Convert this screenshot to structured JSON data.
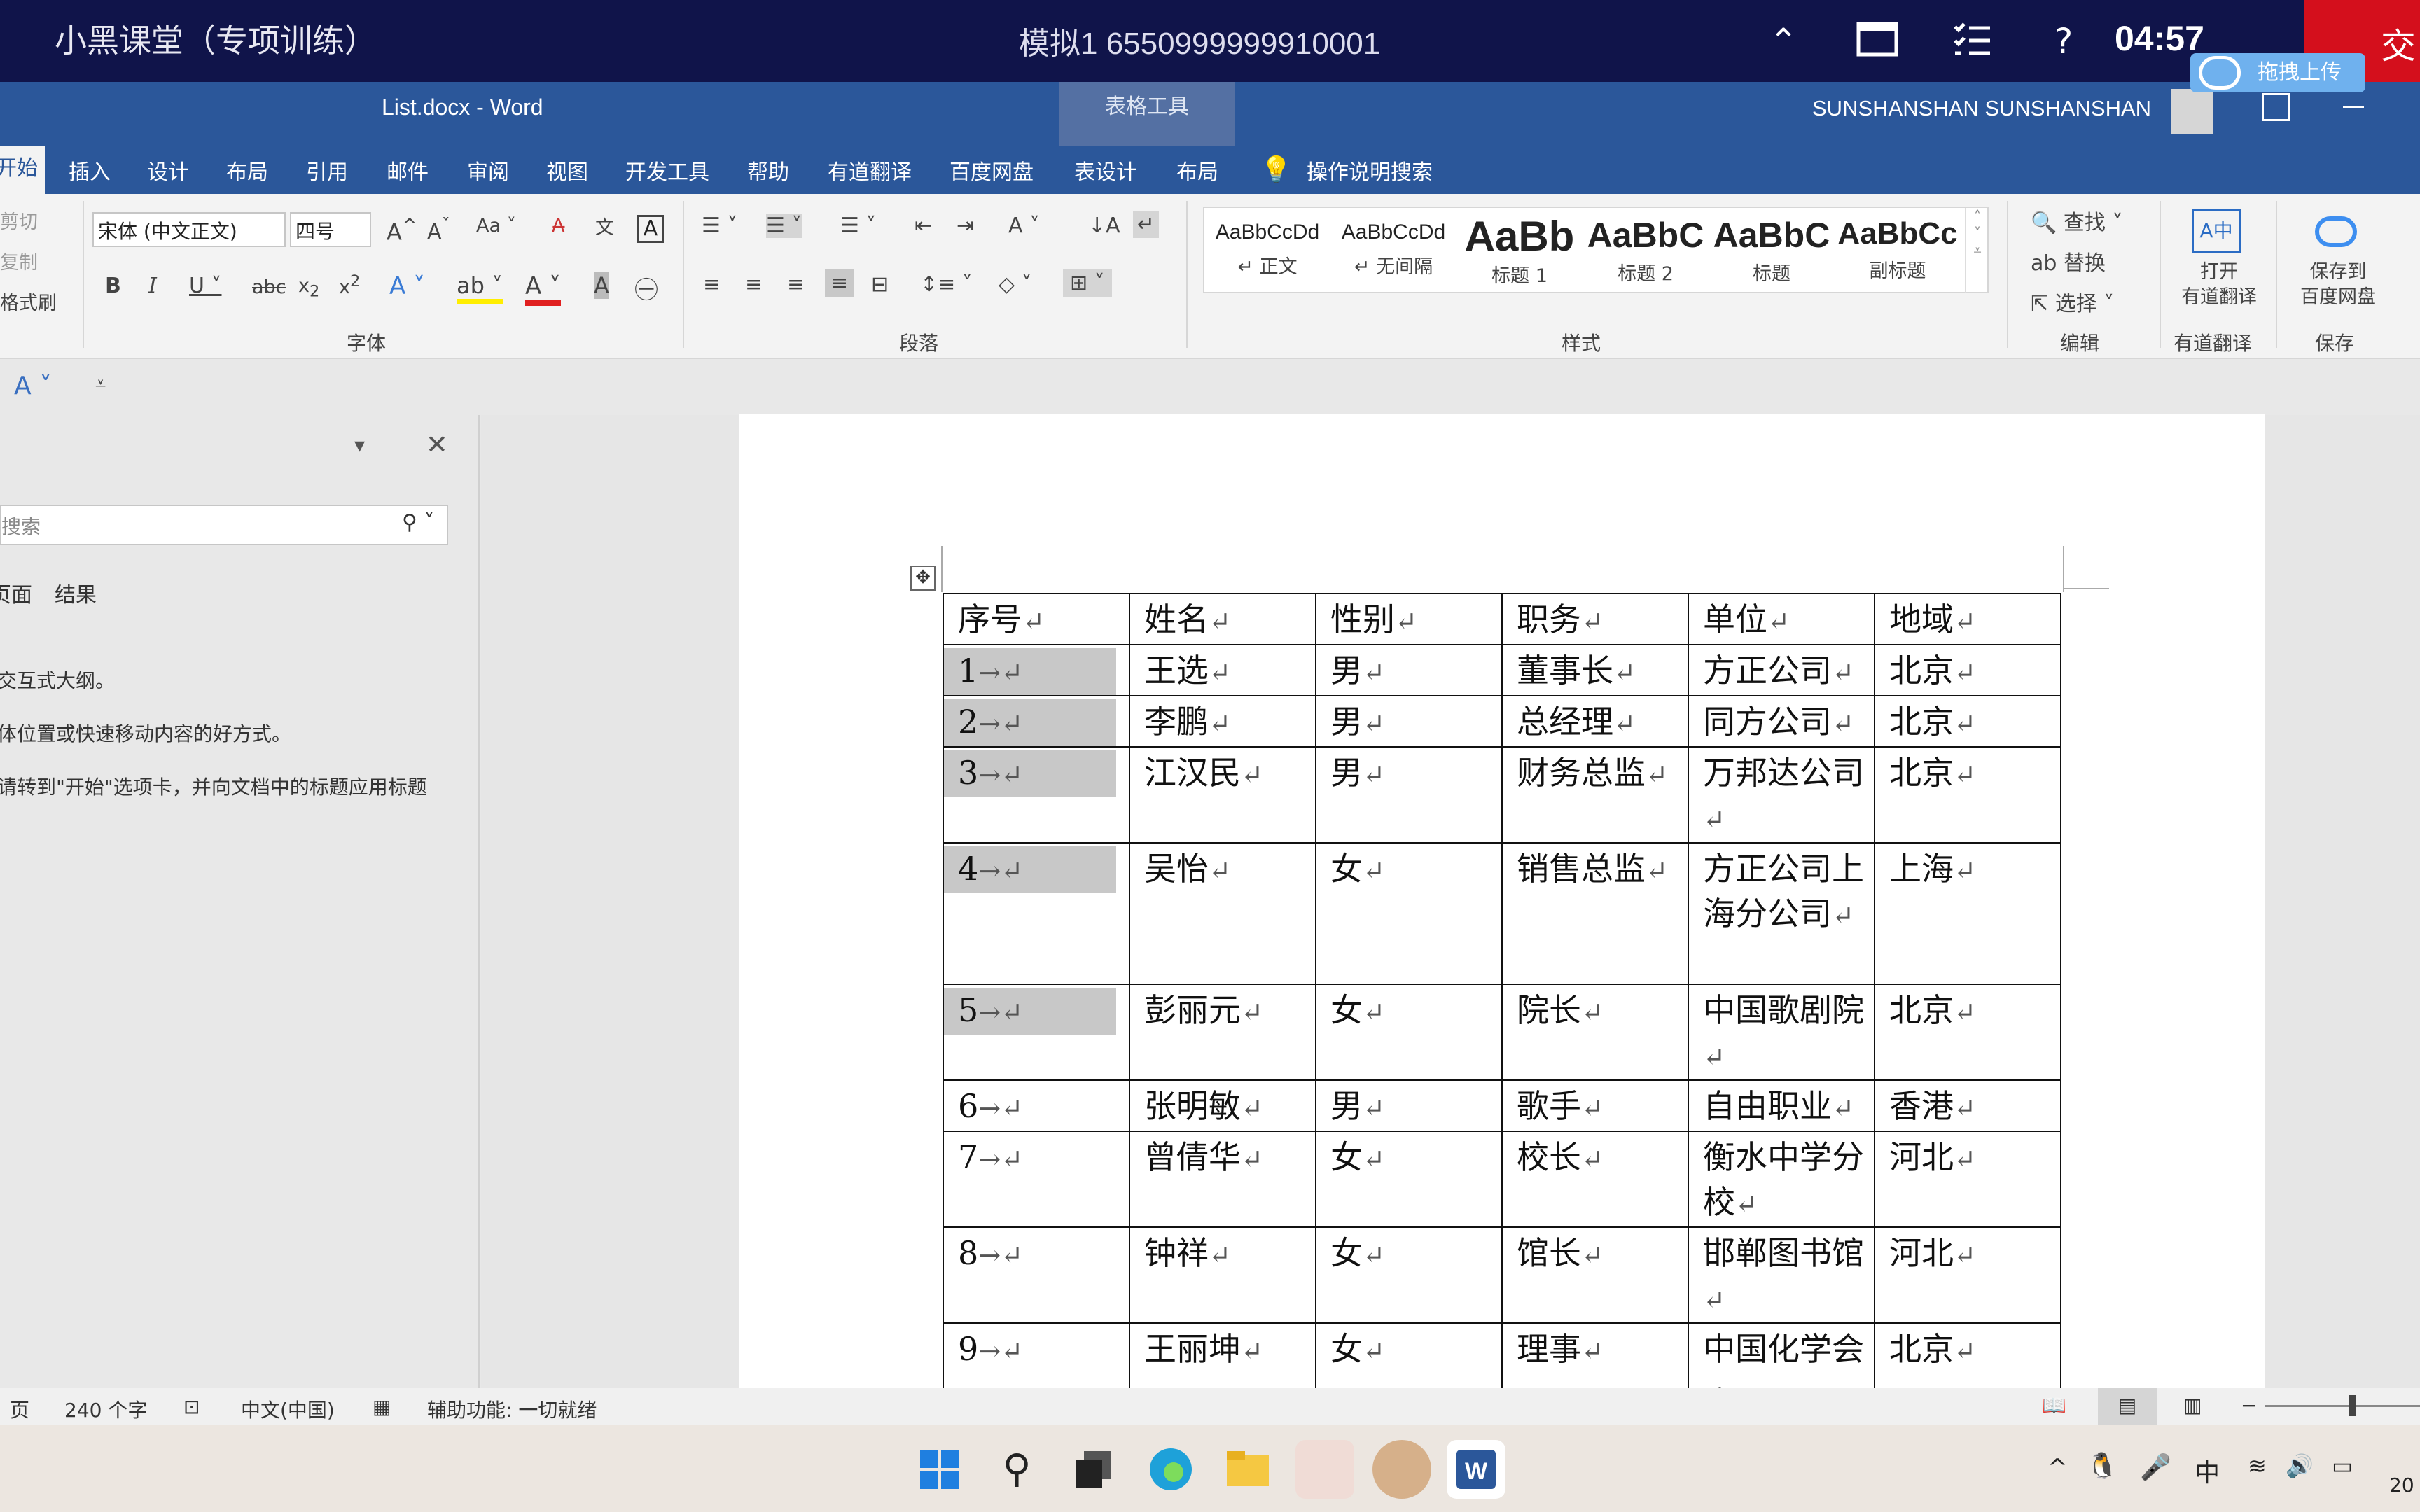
{
  "topbar": {
    "app_title": "小黑课堂（专项训练）",
    "exam": "模拟1  6550999999910001",
    "time": "04:57",
    "submit": "交",
    "upload_btn": "拖拽上传"
  },
  "word": {
    "doc_title": "List.docx  -  Word",
    "table_tools": "表格工具",
    "user": "SUNSHANSHAN SUNSHANSHAN",
    "tabs": [
      "开始",
      "插入",
      "设计",
      "布局",
      "引用",
      "邮件",
      "审阅",
      "视图",
      "开发工具",
      "帮助",
      "有道翻译",
      "百度网盘",
      "表设计",
      "布局"
    ],
    "tell_me": "操作说明搜索"
  },
  "ribbon": {
    "clipboard": [
      "剪切",
      "复制",
      "格式刷"
    ],
    "font_name": "宋体 (中文正文)",
    "font_size": "四号",
    "group_font": "字体",
    "group_paragraph": "段落",
    "group_styles": "样式",
    "group_editing": "编辑",
    "group_translate": "有道翻译",
    "group_save": "保存",
    "styles": [
      {
        "preview": "AaBbCcDd",
        "label": "↵ 正文"
      },
      {
        "preview": "AaBbCcDd",
        "label": "↵ 无间隔"
      },
      {
        "preview": "AaBb",
        "label": "标题 1"
      },
      {
        "preview": "AaBbC",
        "label": "标题 2"
      },
      {
        "preview": "AaBbC",
        "label": "标题"
      },
      {
        "preview": "AaBbCc",
        "label": "副标题"
      }
    ],
    "find": "查找",
    "replace": "替换",
    "select": "选择",
    "open_translate": "打开\n有道翻译",
    "save_baidu": "保存到\n百度网盘"
  },
  "navpane": {
    "search_placeholder": "搜索",
    "tabs": [
      "页面",
      "结果"
    ],
    "line1": "交互式大纲。",
    "line2": "体位置或快速移动内容的好方式。",
    "line3": "请转到\"开始\"选项卡，并向文档中的标题应用标题"
  },
  "table": {
    "headers": [
      "序号",
      "姓名",
      "性别",
      "职务",
      "单位",
      "地域"
    ],
    "rows": [
      [
        "1",
        "王选",
        "男",
        "董事长",
        "方正公司",
        "北京"
      ],
      [
        "2",
        "李鹏",
        "男",
        "总经理",
        "同方公司",
        "北京"
      ],
      [
        "3",
        "江汉民",
        "男",
        "财务总监",
        "万邦达公司",
        "北京"
      ],
      [
        "4",
        "吴怡",
        "女",
        "销售总监",
        "方正公司上海分公司",
        "上海"
      ],
      [
        "5",
        "彭丽元",
        "女",
        "院长",
        "中国歌剧院",
        "北京"
      ],
      [
        "6",
        "张明敏",
        "男",
        "歌手",
        "自由职业",
        "香港"
      ],
      [
        "7",
        "曾倩华",
        "女",
        "校长",
        "衡水中学分校",
        "河北"
      ],
      [
        "8",
        "钟祥",
        "女",
        "馆长",
        "邯郸图书馆",
        "河北"
      ],
      [
        "9",
        "王丽坤",
        "女",
        "理事",
        "中国化学会",
        "北京"
      ]
    ]
  },
  "status": {
    "page": "页",
    "words": "240 个字",
    "language": "中文(中国)",
    "accessibility": "辅助功能: 一切就绪"
  },
  "taskbar": {
    "ime": "中",
    "year_fragment": "20"
  }
}
